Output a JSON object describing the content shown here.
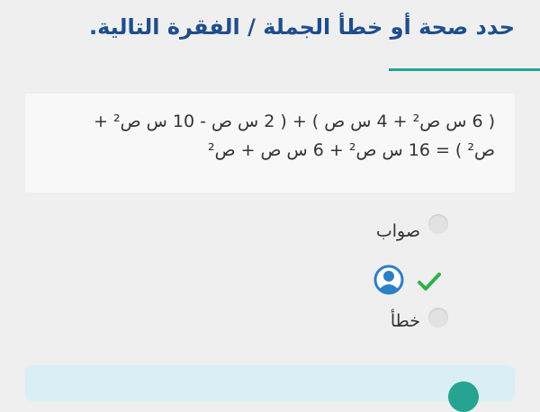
{
  "question": {
    "title": "حدد صحة أو خطأ الجملة / الفقرة التالية.",
    "line1": "( 6 س ص² + 4 س ص ) + ( 2 س ص - 10 س ص² +",
    "line2": "ص² ) = 16 س ص² + 6 س ص + ص²"
  },
  "options": [
    {
      "label": "صواب",
      "selected": false
    },
    {
      "label": "خطأ",
      "selected": false
    }
  ],
  "feedback": {
    "correct_mark": "check-icon",
    "user_marker": "avatar-icon"
  },
  "colors": {
    "title": "#1f4e8c",
    "accent": "#27a392",
    "check": "#2eb04b",
    "avatar": "#2d7fc7",
    "feedback_bg": "#d9eff3"
  }
}
